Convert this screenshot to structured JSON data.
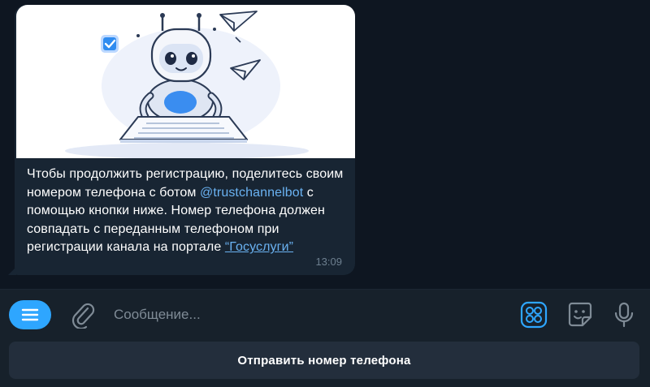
{
  "message": {
    "text_before": "Чтобы продолжить регистрацию, поделитесь своим номером телефона с ботом ",
    "mention": "@trustchannelbot",
    "text_middle": " с помощью кнопки ниже. Номер телефона должен совпадать с переданным телефоном при регистрации канала на портале ",
    "link": "“Госуслуги”",
    "time": "13:09",
    "image_icon": "robot-reading-document-illustration"
  },
  "input": {
    "placeholder": "Сообщение...",
    "value": "",
    "icons": [
      "menu-icon",
      "paperclip-icon",
      "bot-commands-icon",
      "sticker-icon",
      "microphone-icon"
    ]
  },
  "keyboard": {
    "button_label": "Отправить номер телефона"
  },
  "colors": {
    "chat_background": "#0e1621",
    "bubble": "#182533",
    "accent": "#2ea6ff",
    "link": "#6ab2f2",
    "panel": "#17212b",
    "keyboard_button": "#232e3c"
  }
}
